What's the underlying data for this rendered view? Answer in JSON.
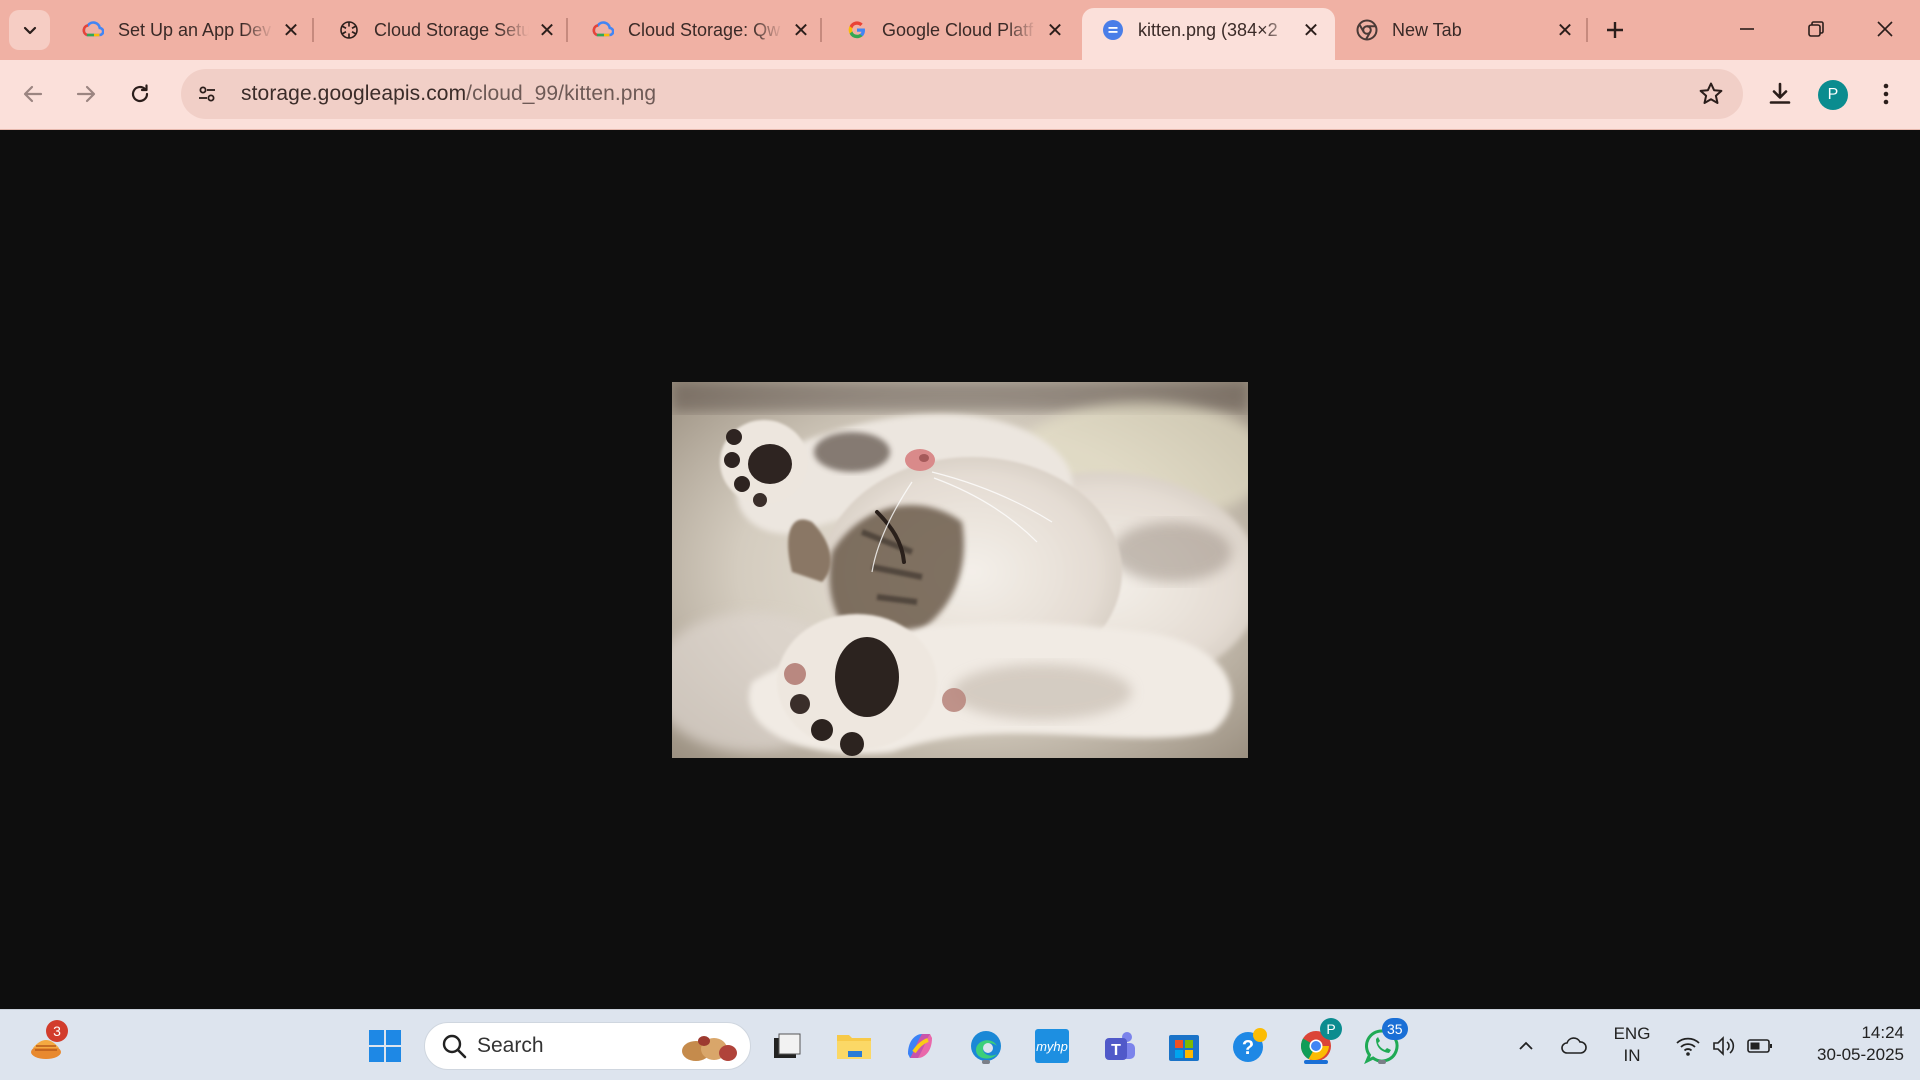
{
  "browser": {
    "tabs": [
      {
        "title": "Set Up an App Dev",
        "favicon": "gcp-icon",
        "active": false
      },
      {
        "title": "Cloud Storage Setu",
        "favicon": "chatgpt-icon",
        "active": false
      },
      {
        "title": "Cloud Storage: Qw",
        "favicon": "gcp-icon",
        "active": false
      },
      {
        "title": "Google Cloud Platf",
        "favicon": "google-icon",
        "active": false
      },
      {
        "title": "kitten.png (384×2",
        "favicon": "image-doc-icon",
        "active": true
      },
      {
        "title": "New Tab",
        "favicon": "chrome-icon",
        "active": false
      }
    ],
    "address": {
      "host": "storage.googleapis.com",
      "path": "/cloud_99/kitten.png"
    },
    "profile_initial": "P",
    "colors": {
      "tabstrip": "#f0b1a4",
      "toolbar": "#fbe0da",
      "profile": "#0b8c8f"
    }
  },
  "content": {
    "image_subject": "sleeping kitten",
    "background": "#0e0e0e"
  },
  "taskbar": {
    "search_placeholder": "Search",
    "widget_badge": "3",
    "whatsapp_badge": "35",
    "chrome_profile_badge": "P",
    "language": {
      "line1": "ENG",
      "line2": "IN"
    },
    "clock": {
      "time": "14:24",
      "date": "30-05-2025"
    },
    "apps": [
      "start-icon",
      "search",
      "file-manager-icon",
      "file-explorer-icon",
      "copilot-icon",
      "edge-icon",
      "myhp-icon",
      "teams-icon",
      "store-icon",
      "help-icon",
      "chrome-icon",
      "whatsapp-icon"
    ]
  }
}
